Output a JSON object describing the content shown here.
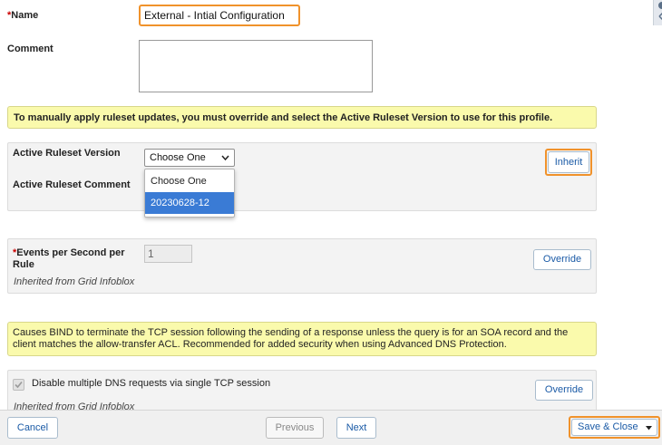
{
  "form": {
    "name": {
      "required_mark": "*",
      "label": "Name",
      "value": "External - Intial Configuration"
    },
    "comment": {
      "label": "Comment",
      "value": ""
    }
  },
  "ruleset_note": "To manually apply ruleset updates, you must override and select the Active Ruleset Version to use for this profile.",
  "ruleset_panel": {
    "version_label": "Active Ruleset Version",
    "comment_label": "Active Ruleset Comment",
    "select_value": "Choose One",
    "options": [
      "Choose One",
      "20230628-12"
    ],
    "highlighted_option_index": 1,
    "inherit_label": "Inherit"
  },
  "eps_panel": {
    "required_mark": "*",
    "label": "Events per Second per Rule",
    "value": "1",
    "inherited_text": "Inherited from Grid Infoblox",
    "override_label": "Override"
  },
  "tcp_note": "Causes BIND to terminate the TCP session following the sending of a response unless the query is for an SOA record and the client matches the allow-transfer ACL. Recommended for added security when using Advanced DNS Protection.",
  "tcp_panel": {
    "checkbox_label": "Disable multiple DNS requests via single TCP session",
    "checked": true,
    "inherited_text": "Inherited from Grid Infoblox",
    "override_label": "Override"
  },
  "footer": {
    "cancel_label": "Cancel",
    "previous_label": "Previous",
    "next_label": "Next",
    "save_close_label": "Save & Close",
    "save_menu_icon": "caret-down-icon"
  },
  "colors": {
    "highlight": "#f0922b",
    "note_bg": "#fafaac",
    "link_blue": "#1a5aa6",
    "selected_option": "#3a7bd5"
  }
}
